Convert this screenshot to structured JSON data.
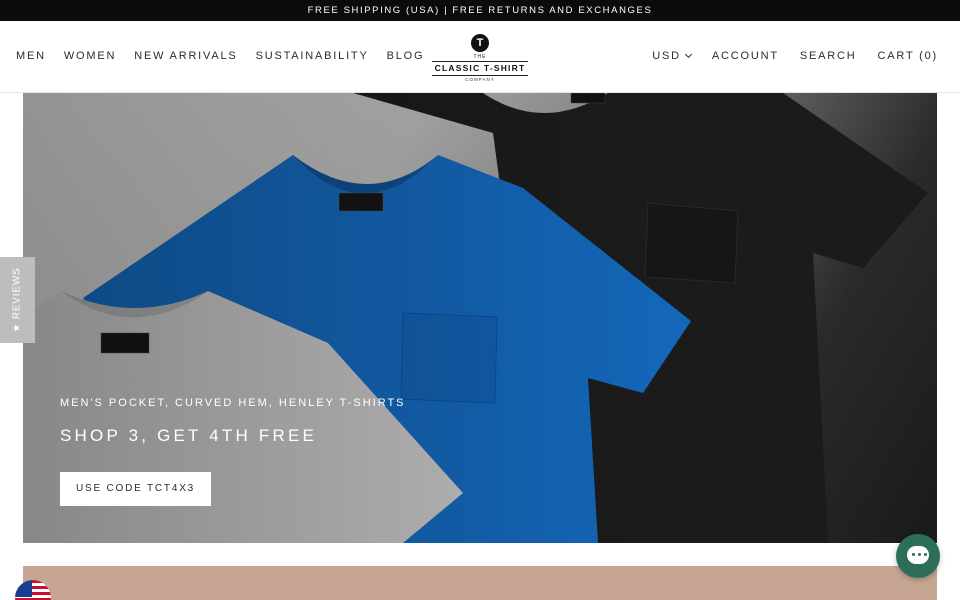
{
  "announcement": "FREE SHIPPING (USA) | FREE RETURNS AND EXCHANGES",
  "logo": {
    "mark": "T",
    "the": "THE",
    "name": "CLASSIC T-SHIRT",
    "company": "COMPANY"
  },
  "nav_left": [
    "MEN",
    "WOMEN",
    "NEW ARRIVALS",
    "SUSTAINABILITY",
    "BLOG"
  ],
  "nav_right": {
    "currency": "USD",
    "account": "ACCOUNT",
    "search": "SEARCH",
    "cart": "CART (0)"
  },
  "hero": {
    "subtitle": "MEN'S POCKET, CURVED HEM, HENLEY T-SHIRTS",
    "title": "SHOP 3, GET 4TH FREE",
    "button": "USE CODE TCT4X3"
  },
  "reviews_tab": "★ REVIEWS",
  "icons": {
    "chat": "chat-icon",
    "flag": "us-flag-icon",
    "currency_dropdown": "chevron-down-icon"
  },
  "colors": {
    "announcement_bg": "#0b0b0b",
    "promo_band": "#c6a693",
    "chat": "#2d6e58",
    "shirt_blue": "#1466b8"
  }
}
